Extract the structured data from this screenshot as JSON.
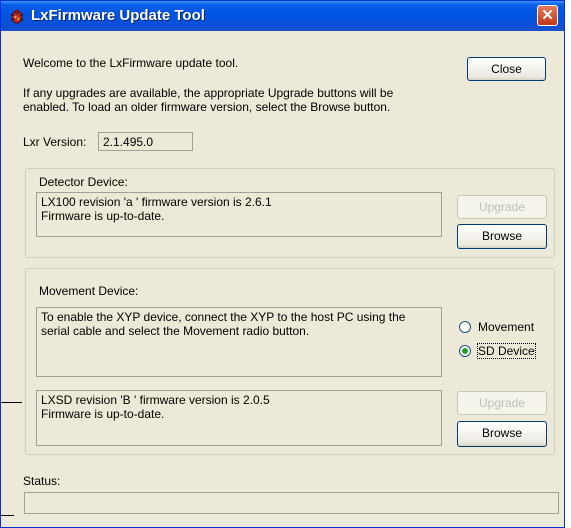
{
  "window": {
    "title": "LxFirmware Update Tool",
    "close_glyph": "✕",
    "colors": {
      "titlebar": "#0054e3",
      "body": "#ece9d8",
      "close": "#c5341a"
    }
  },
  "intro": {
    "welcome": "Welcome to the LxFirmware update tool.",
    "info_line1": "If any upgrades are available, the appropriate Upgrade buttons will be",
    "info_line2": "enabled.  To load an older firmware version, select the Browse button."
  },
  "close_button": {
    "label": "Close"
  },
  "lxr_version": {
    "label": "Lxr Version:",
    "value": "2.1.495.0"
  },
  "detector": {
    "title": "Detector Device:",
    "line1": "LX100 revision 'a ' firmware version is 2.6.1",
    "line2": "Firmware is up-to-date.",
    "upgrade_label": "Upgrade",
    "browse_label": "Browse"
  },
  "movement": {
    "title": "Movement Device:",
    "info_line1": "To enable the XYP device, connect the XYP to the host PC using the",
    "info_line2": "serial cable and select the Movement radio button.",
    "radio_movement": "Movement",
    "radio_sd": "SD Device",
    "selected": "SD Device",
    "sd_line1": "LXSD revision 'B  ' firmware version is 2.0.5",
    "sd_line2": "Firmware is up-to-date.",
    "upgrade_label": "Upgrade",
    "browse_label": "Browse"
  },
  "status": {
    "label": "Status:",
    "value": ""
  }
}
